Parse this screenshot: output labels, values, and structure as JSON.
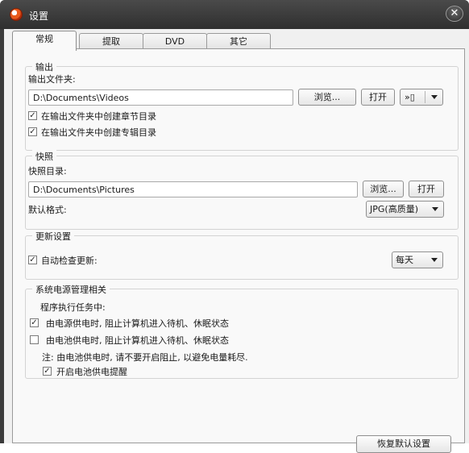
{
  "window": {
    "title": "设置"
  },
  "tabs": [
    "常规",
    "提取",
    "DVD",
    "其它"
  ],
  "output": {
    "legend": "输出",
    "folder_label": "输出文件夹:",
    "folder_value": "D:\\Documents\\Videos",
    "browse_label": "浏览...",
    "open_label": "打开",
    "extra_icons": "»▯",
    "create_chapter_dir": {
      "label": "在输出文件夹中创建章节目录",
      "checked": true
    },
    "create_album_dir": {
      "label": "在输出文件夹中创建专辑目录",
      "checked": true
    }
  },
  "snapshot": {
    "legend": "快照",
    "dir_label": "快照目录:",
    "dir_value": "D:\\Documents\\Pictures",
    "browse_label": "浏览...",
    "open_label": "打开",
    "format_label": "默认格式:",
    "format_value": "JPG(高质量)"
  },
  "update": {
    "legend": "更新设置",
    "auto_check_label": "自动检查更新:",
    "auto_check_checked": true,
    "frequency_value": "每天"
  },
  "power": {
    "legend": "系统电源管理相关",
    "during_task_label": "程序执行任务中:",
    "ac_label": "由电源供电时, 阻止计算机进入待机、休眠状态",
    "ac_checked": true,
    "battery_label": "由电池供电时, 阻止计算机进入待机、休眠状态",
    "battery_checked": false,
    "note": "注: 由电池供电时, 请不要开启阻止, 以避免电量耗尽.",
    "battery_reminder_label": "开启电池供电提醒",
    "battery_reminder_checked": true
  },
  "restore_defaults_label": "恢复默认设置",
  "check_mark": "✓"
}
